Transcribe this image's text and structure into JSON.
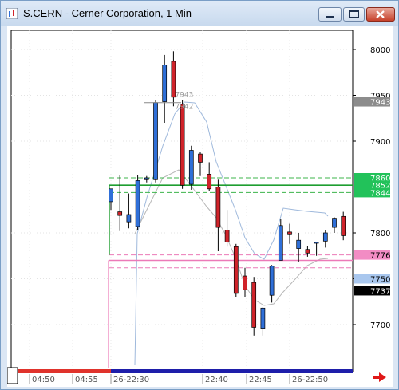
{
  "window": {
    "title": "S.CERN - Cerner Corporation, 1 Min",
    "buttons": [
      {
        "name": "minimize-button",
        "icon": "minimize-icon"
      },
      {
        "name": "maximize-button",
        "icon": "maximize-icon"
      },
      {
        "name": "close-button",
        "icon": "close-icon"
      }
    ]
  },
  "colors": {
    "up": "#2f6fd8",
    "down": "#d0232a",
    "green_line": "#3cb44b",
    "pink_line": "#ec7ab8",
    "band": "#9fb9dc",
    "axis_text": "#000000"
  },
  "chart_data": {
    "type": "candlestick",
    "ylim": [
      7660,
      8020
    ],
    "y_ticks": [
      "8000",
      "7950",
      "7900",
      "7850",
      "7800",
      "7750",
      "7700"
    ],
    "x_ticks": [
      "04:50",
      "04:55",
      "26-22:30",
      "22:40",
      "22:45",
      "26-22:50"
    ],
    "annotations": [
      "7943",
      "7942"
    ],
    "price_tags": [
      {
        "label": "7943",
        "value": 7943,
        "bg": "#8c8c8c",
        "fg": "#ffffff"
      },
      {
        "label": "7860",
        "value": 7860,
        "bg": "#22c25a",
        "fg": "#ffffff"
      },
      {
        "label": "7852",
        "value": 7852,
        "bg": "#22c25a",
        "fg": "#ffffff"
      },
      {
        "label": "7844",
        "value": 7844,
        "bg": "#22c25a",
        "fg": "#ffffff"
      },
      {
        "label": "7776",
        "value": 7776,
        "bg": "#f28cc4",
        "fg": "#000000"
      },
      {
        "label": "7750",
        "value": 7750,
        "bg": "#a9c7ee",
        "fg": "#000000"
      },
      {
        "label": "7737",
        "value": 7737,
        "bg": "#000000",
        "fg": "#ffffff"
      }
    ],
    "candles": [
      {
        "o": 7834,
        "h": 7848,
        "l": 7825,
        "c": 7848
      },
      {
        "o": 7823,
        "h": 7863,
        "l": 7802,
        "c": 7819
      },
      {
        "o": 7812,
        "h": 7843,
        "l": 7805,
        "c": 7820
      },
      {
        "o": 7807,
        "h": 7863,
        "l": 7803,
        "c": 7857
      },
      {
        "o": 7858,
        "h": 7862,
        "l": 7855,
        "c": 7860
      },
      {
        "o": 7858,
        "h": 7945,
        "l": 7855,
        "c": 7942
      },
      {
        "o": 7943,
        "h": 7994,
        "l": 7920,
        "c": 7983
      },
      {
        "o": 7987,
        "h": 7998,
        "l": 7938,
        "c": 7948
      },
      {
        "o": 7940,
        "h": 7945,
        "l": 7848,
        "c": 7852
      },
      {
        "o": 7853,
        "h": 7895,
        "l": 7847,
        "c": 7890
      },
      {
        "o": 7886,
        "h": 7888,
        "l": 7862,
        "c": 7877
      },
      {
        "o": 7864,
        "h": 7877,
        "l": 7846,
        "c": 7848
      },
      {
        "o": 7850,
        "h": 7858,
        "l": 7780,
        "c": 7806
      },
      {
        "o": 7803,
        "h": 7825,
        "l": 7785,
        "c": 7790
      },
      {
        "o": 7785,
        "h": 7788,
        "l": 7730,
        "c": 7734
      },
      {
        "o": 7753,
        "h": 7762,
        "l": 7730,
        "c": 7738
      },
      {
        "o": 7746,
        "h": 7752,
        "l": 7688,
        "c": 7697
      },
      {
        "o": 7696,
        "h": 7719,
        "l": 7688,
        "c": 7718
      },
      {
        "o": 7732,
        "h": 7765,
        "l": 7724,
        "c": 7764
      },
      {
        "o": 7770,
        "h": 7815,
        "l": 7770,
        "c": 7808
      },
      {
        "o": 7801,
        "h": 7810,
        "l": 7788,
        "c": 7798
      },
      {
        "o": 7783,
        "h": 7800,
        "l": 7768,
        "c": 7792
      },
      {
        "o": 7782,
        "h": 7786,
        "l": 7774,
        "c": 7778
      },
      {
        "o": 7790,
        "h": 7790,
        "l": 7775,
        "c": 7790
      },
      {
        "o": 7791,
        "h": 7803,
        "l": 7784,
        "c": 7800
      },
      {
        "o": 7806,
        "h": 7817,
        "l": 7800,
        "c": 7816
      },
      {
        "o": 7818,
        "h": 7823,
        "l": 7792,
        "c": 7797
      }
    ],
    "h_levels": [
      {
        "value": 7860,
        "color": "#3cb44b",
        "style": "dash"
      },
      {
        "value": 7852,
        "color": "#1f9e30",
        "style": "solid"
      },
      {
        "value": 7844,
        "color": "#3cb44b",
        "style": "dash"
      },
      {
        "value": 7776,
        "color": "#ec7ab8",
        "style": "dash"
      },
      {
        "value": 7770,
        "color": "#ec7ab8",
        "style": "solid"
      },
      {
        "value": 7762,
        "color": "#ec7ab8",
        "style": "dash"
      }
    ]
  }
}
